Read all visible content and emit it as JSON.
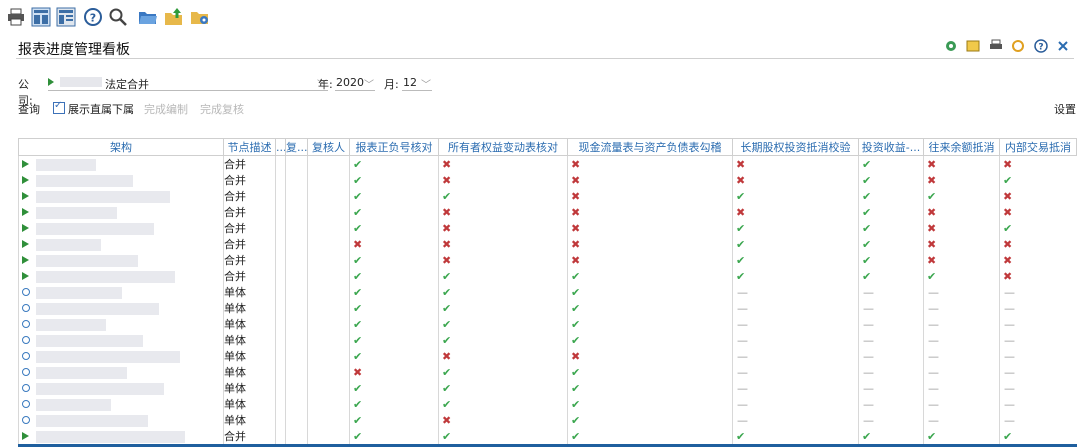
{
  "toolbar": {
    "icons": [
      "print-icon",
      "layout-grid-icon",
      "layout-form-icon",
      "help-icon",
      "search-icon",
      "folder-open-icon",
      "folder-upload-icon",
      "folder-settings-icon"
    ]
  },
  "header": {
    "title": "报表进度管理看板",
    "right_icons": [
      "settings-gear-icon",
      "note-icon",
      "print-icon",
      "refresh-icon",
      "help-icon",
      "close-icon"
    ]
  },
  "filters": {
    "company_label": "公司:",
    "company_value": "法定合并",
    "year_label": "年:",
    "year_value": "2020",
    "month_label": "月:",
    "month_value": "12"
  },
  "actions": {
    "query": "查询",
    "show_direct_sub": "展示直属下属",
    "complete_edit": "完成编制",
    "complete_review": "完成复核",
    "settings": "设置"
  },
  "columns": [
    "架构",
    "节点描述",
    "...",
    "复...",
    "复核人",
    "报表正负号核对",
    "所有者权益变动表核对",
    "现金流量表与资产负债表勾稽",
    "长期股权投资抵消校验",
    "投资收益-...",
    "往来余额抵消",
    "内部交易抵消"
  ],
  "rows": [
    {
      "type": "group",
      "desc": "合并",
      "checks": [
        "ok",
        "no",
        "no",
        "no",
        "ok",
        "no",
        "no"
      ]
    },
    {
      "type": "group",
      "desc": "合并",
      "checks": [
        "ok",
        "no",
        "no",
        "no",
        "ok",
        "no",
        "ok"
      ]
    },
    {
      "type": "group",
      "desc": "合并",
      "checks": [
        "ok",
        "ok",
        "no",
        "ok",
        "ok",
        "ok",
        "no"
      ]
    },
    {
      "type": "group",
      "desc": "合并",
      "checks": [
        "ok",
        "no",
        "no",
        "no",
        "ok",
        "no",
        "no"
      ]
    },
    {
      "type": "group",
      "desc": "合并",
      "checks": [
        "ok",
        "no",
        "no",
        "ok",
        "ok",
        "no",
        "ok"
      ]
    },
    {
      "type": "group",
      "desc": "合并",
      "checks": [
        "no",
        "no",
        "no",
        "ok",
        "ok",
        "no",
        "no"
      ]
    },
    {
      "type": "group",
      "desc": "合并",
      "checks": [
        "ok",
        "no",
        "no",
        "ok",
        "ok",
        "no",
        "no"
      ]
    },
    {
      "type": "group",
      "desc": "合并",
      "checks": [
        "ok",
        "ok",
        "ok",
        "ok",
        "ok",
        "ok",
        "no"
      ]
    },
    {
      "type": "single",
      "desc": "单体",
      "checks": [
        "ok",
        "ok",
        "ok",
        "na",
        "na",
        "na",
        "na"
      ]
    },
    {
      "type": "single",
      "desc": "单体",
      "checks": [
        "ok",
        "ok",
        "ok",
        "na",
        "na",
        "na",
        "na"
      ]
    },
    {
      "type": "single",
      "desc": "单体",
      "checks": [
        "ok",
        "ok",
        "ok",
        "na",
        "na",
        "na",
        "na"
      ]
    },
    {
      "type": "single",
      "desc": "单体",
      "checks": [
        "ok",
        "ok",
        "ok",
        "na",
        "na",
        "na",
        "na"
      ]
    },
    {
      "type": "single",
      "desc": "单体",
      "checks": [
        "ok",
        "no",
        "no",
        "na",
        "na",
        "na",
        "na"
      ]
    },
    {
      "type": "single",
      "desc": "单体",
      "checks": [
        "no",
        "ok",
        "ok",
        "na",
        "na",
        "na",
        "na"
      ]
    },
    {
      "type": "single",
      "desc": "单体",
      "checks": [
        "ok",
        "ok",
        "ok",
        "na",
        "na",
        "na",
        "na"
      ]
    },
    {
      "type": "single",
      "desc": "单体",
      "checks": [
        "ok",
        "ok",
        "ok",
        "na",
        "na",
        "na",
        "na"
      ]
    },
    {
      "type": "single",
      "desc": "单体",
      "checks": [
        "ok",
        "no",
        "ok",
        "na",
        "na",
        "na",
        "na"
      ]
    },
    {
      "type": "group",
      "desc": "合并",
      "checks": [
        "ok",
        "ok",
        "ok",
        "ok",
        "ok",
        "ok",
        "ok"
      ]
    }
  ],
  "colors": {
    "ok": "#3aa64e",
    "no": "#c0393b",
    "accent": "#2b6cb0"
  }
}
